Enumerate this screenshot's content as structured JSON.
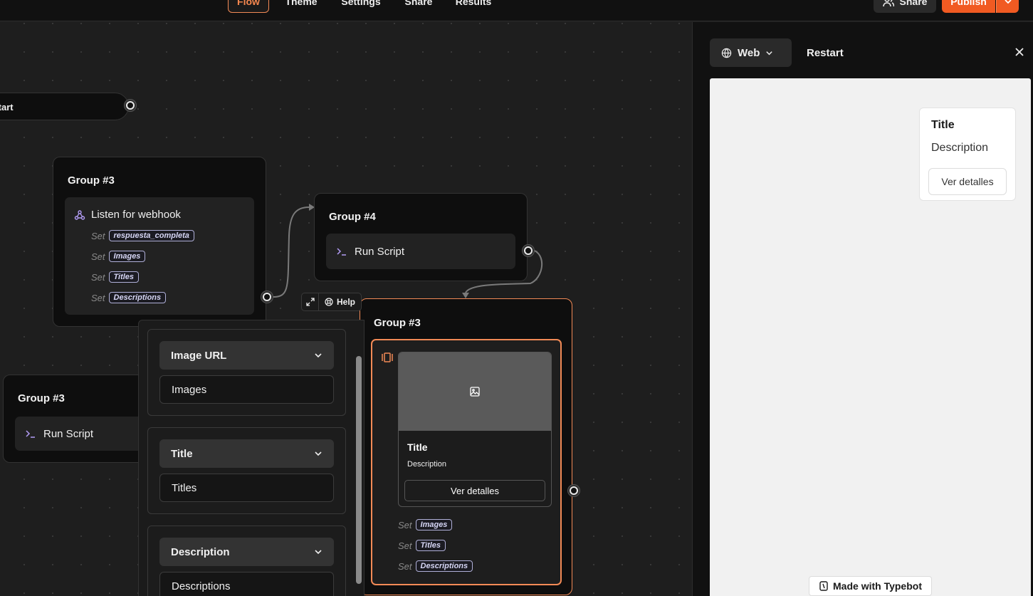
{
  "topbar": {
    "tabs": [
      {
        "label": "Flow",
        "active": true
      },
      {
        "label": "Theme",
        "active": false
      },
      {
        "label": "Settings",
        "active": false
      },
      {
        "label": "Share",
        "active": false
      },
      {
        "label": "Results",
        "active": false
      }
    ],
    "share_label": "Share",
    "publish_label": "Publish"
  },
  "canvas": {
    "start_node": {
      "label": "Start"
    },
    "group_webhook": {
      "title": "Group #3",
      "block_label": "Listen for webhook",
      "set_prefix": "Set",
      "variables": [
        "respuesta_completa",
        "Images",
        "Titles",
        "Descriptions"
      ]
    },
    "group_script_top": {
      "title": "Group #4",
      "block_label": "Run Script"
    },
    "group_script_left": {
      "title": "Group #3",
      "block_label": "Run Script"
    },
    "group_carousel": {
      "title": "Group #3",
      "card_title": "Title",
      "card_description": "Description",
      "card_button": "Ver detalles",
      "set_prefix": "Set",
      "variables": [
        "Images",
        "Titles",
        "Descriptions"
      ]
    },
    "help_bar": {
      "help_label": "Help"
    },
    "popover": {
      "sections": [
        {
          "select_label": "Image URL",
          "input_value": "Images"
        },
        {
          "select_label": "Title",
          "input_value": "Titles"
        },
        {
          "select_label": "Description",
          "input_value": "Descriptions"
        }
      ]
    }
  },
  "preview_panel": {
    "device_label": "Web",
    "restart_label": "Restart",
    "card_title": "Title",
    "card_description": "Description",
    "card_button": "Ver detalles",
    "made_with_label": "Made with Typebot"
  },
  "colors": {
    "accent": "#f15a22",
    "active_tab": "#f5874f",
    "variable_tag": "#b0b0d8",
    "canvas_bg": "#1e1e1e",
    "preview_bg": "#f1f1f1"
  }
}
